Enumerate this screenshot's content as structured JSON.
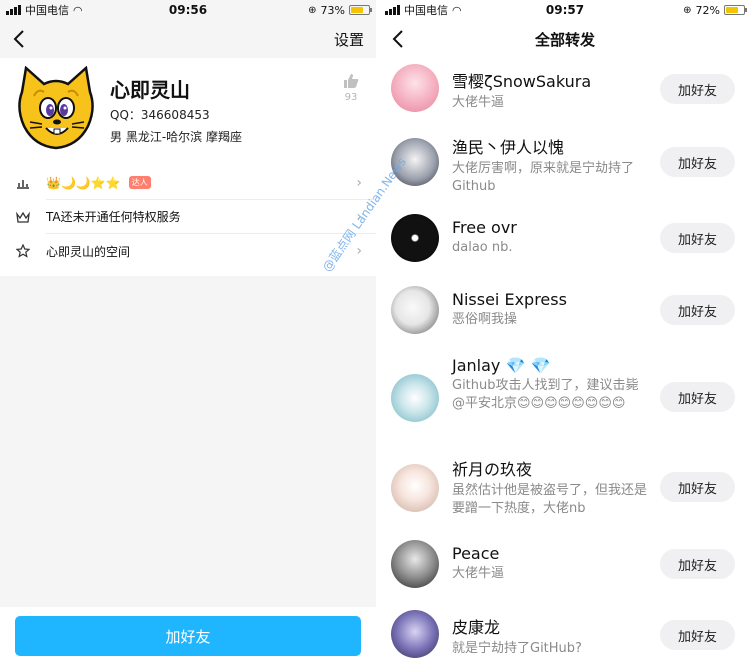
{
  "left": {
    "status": {
      "carrier": "中国电信",
      "time": "09:56",
      "battery": "73%",
      "battery_level": 0.73
    },
    "nav": {
      "action": "设置"
    },
    "profile": {
      "nickname": "心即灵山",
      "qq": "QQ：346608453",
      "meta": "男  黑龙江-哈尔滨  摩羯座",
      "likes": "93"
    },
    "menu": [
      {
        "label": "👑🌙🌙⭐⭐",
        "badge": "达人",
        "icon": "level-icon"
      },
      {
        "label": "TA还未开通任何特权服务",
        "icon": "crown-icon"
      },
      {
        "label": "心即灵山的空间",
        "icon": "star-icon"
      }
    ],
    "add_friend": "加好友"
  },
  "watermark": "@蓝点网 Landian.News",
  "right": {
    "status": {
      "carrier": "中国电信",
      "time": "09:57",
      "battery": "72%",
      "battery_level": 0.72
    },
    "nav": {
      "title": "全部转发"
    },
    "items": [
      {
        "name": "雪樱ζSnowSakura",
        "sub": "大佬牛逼",
        "button": "加好友"
      },
      {
        "name": "渔民丶伊人以愧",
        "sub": "大佬厉害啊，原来就是宁劫持了Github",
        "button": "加好友"
      },
      {
        "name": "Free ovr",
        "sub": "dalao nb.",
        "button": "加好友"
      },
      {
        "name": "Nissei Express",
        "sub": "恶俗啊我操",
        "button": "加好友"
      },
      {
        "name": "Janlay 💎 💎",
        "sub": "Github攻击人找到了，建议击毙@平安北京😊😊😊😊😊😊😊😊",
        "button": "加好友"
      },
      {
        "name": "祈月の玖夜",
        "sub": "虽然估计他是被盗号了，但我还是要蹭一下热度，大佬nb",
        "button": "加好友"
      },
      {
        "name": "Peace",
        "sub": "大佬牛逼",
        "button": "加好友"
      },
      {
        "name": "皮康龙",
        "sub": "就是宁劫持了GitHub?",
        "button": "加好友"
      }
    ]
  }
}
